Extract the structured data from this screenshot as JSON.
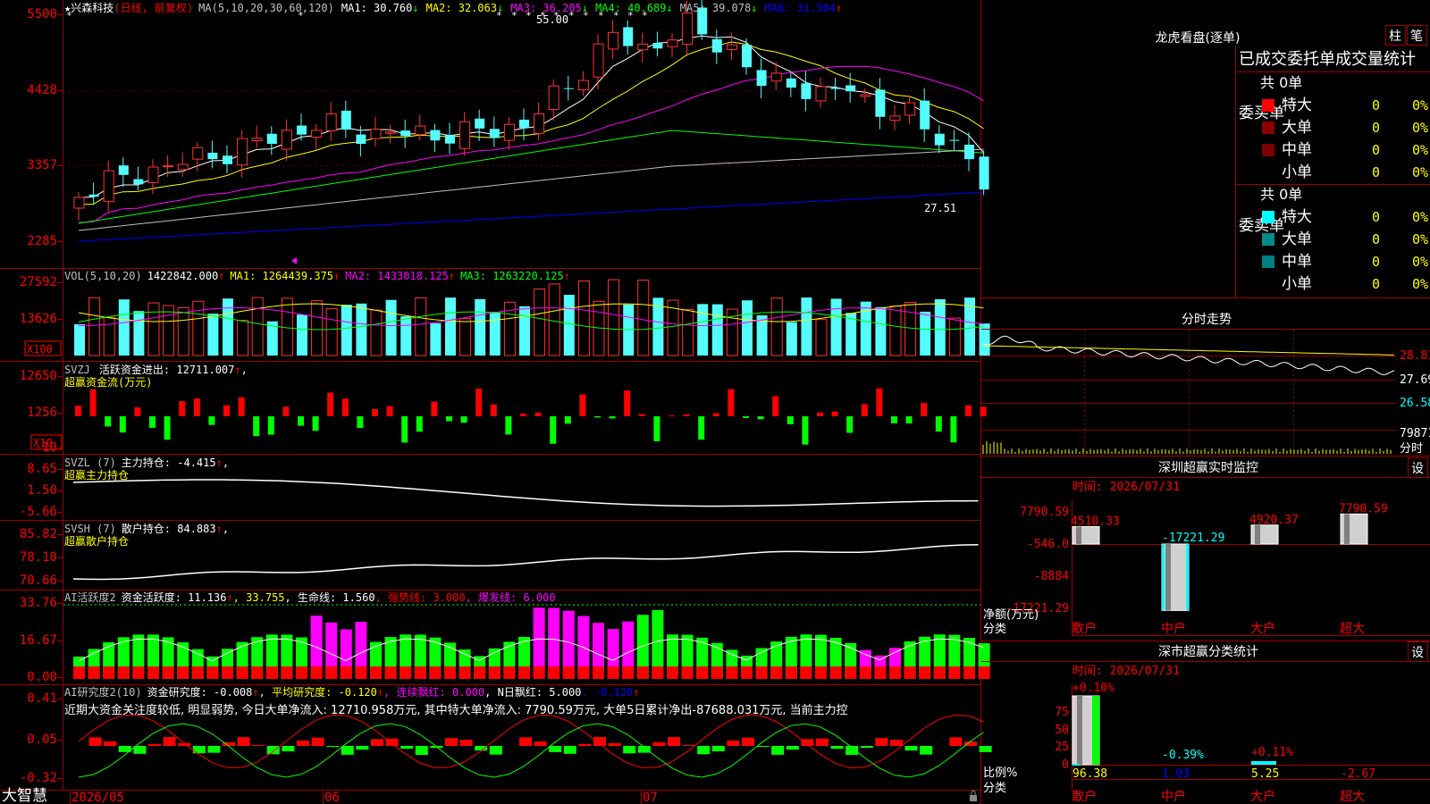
{
  "stock": {
    "prefix": "★",
    "name": "兴森科技",
    "mode": "(日线, 前复权)",
    "flag_icon": "star-icon"
  },
  "main": {
    "ma_spec": "MA(5,10,20,30,60,120)",
    "ma": [
      {
        "label": "MA1: 30.760",
        "arrow": "↓",
        "color": "#ffffff"
      },
      {
        "label": "MA2: 32.063",
        "arrow": "↓",
        "color": "#ffff00"
      },
      {
        "label": "MA3: 36.205",
        "arrow": "↓",
        "color": "#ff00ff"
      },
      {
        "label": "MA4: 40.689",
        "arrow": "↓",
        "color": "#00ff00"
      },
      {
        "label": "MA5: 39.078",
        "arrow": "↓",
        "color": "#c0c0c0"
      },
      {
        "label": "MA6: 31.504",
        "arrow": "↑",
        "color": "#0000ff"
      }
    ],
    "yticks": [
      "5500",
      "4428",
      "3357",
      "2285"
    ],
    "high_label": "55.00",
    "low_label": "27.51"
  },
  "vol": {
    "spec": "VOL(5,10,20)",
    "value": "1422842.000",
    "arrow": "↑",
    "ma": [
      {
        "label": "MA1: 1264439.375",
        "arrow": "↑",
        "color": "#ffff00"
      },
      {
        "label": "MA2: 1433018.125",
        "arrow": "↑",
        "color": "#ff00ff"
      },
      {
        "label": "MA3: 1263220.125",
        "arrow": "↑",
        "color": "#00ff00"
      }
    ],
    "yticks": [
      "27592",
      "13626"
    ],
    "unit": "X100"
  },
  "svzj": {
    "spec": "SVZJ",
    "title": "活跃资金进出: 12711.007",
    "arrow": "↑",
    "tail": ",",
    "sub": "超赢资金流(万元)",
    "yticks": [
      "12650",
      "1256",
      "-10"
    ],
    "unit": "X10"
  },
  "svzl": {
    "spec": "SVZL (7)",
    "title": "主力持仓: -4.415",
    "arrow": "↑",
    "tail": ",",
    "sub": "超赢主力持仓",
    "yticks": [
      "8.65",
      "1.50",
      "-5.66"
    ]
  },
  "svsh": {
    "spec": "SVSH (7)",
    "title": "散户持仓: 84.883",
    "arrow": "↑",
    "tail": ",",
    "sub": "超赢散户持仓",
    "yticks": [
      "85.82",
      "78.10",
      "70.66"
    ]
  },
  "ai1": {
    "spec": "AI活跃度2",
    "title": "资金活跃度: 11.136",
    "arrow": "↑",
    "v2": ", 33.755",
    "life": ", 生命线: 1.560",
    "strong": ", 强势线: 3.000",
    "burst": ", 爆发线: 6.000",
    "yticks": [
      "33.76",
      "16.67",
      "0.00"
    ]
  },
  "ai2": {
    "spec": "AI研究度2(10)",
    "title": "资金研究度: -0.008",
    "arrow": "↑",
    "avg": ", 平均研究度: -0.120",
    "avg_arrow": "↑",
    "cont": ", 连续飘红: 0.000",
    "nday": ", N日飘红: 5.000",
    "last": ", -0.120",
    "last_arrow": "↑",
    "comment": "近期大资金关注度较低, 明显弱势, 今日大单净流入: 12710.958万元, 其中特大单净流入: 7790.59万元, 大单5日累计净出-87688.031万元, 当前主力控",
    "yticks": [
      "0.41",
      "0.05",
      "-0.32"
    ]
  },
  "bottom": {
    "brand": "大智慧",
    "dates": [
      "2026/05",
      "06",
      "07"
    ]
  },
  "right": {
    "lhb_title": "龙虎看盘(逐单)",
    "tabs": [
      "柱",
      "笔"
    ],
    "stats_title": "已成交委托单成交量统计",
    "buy_label": "委买单",
    "sell_label": "委卖单",
    "buy_total": "共 0单",
    "sell_total": "共 0单",
    "buy_rows": [
      {
        "name": "特大",
        "v": "0",
        "p": "0%",
        "color": "#ff0000"
      },
      {
        "name": "大单",
        "v": "0",
        "p": "0%",
        "color": "#8b0000"
      },
      {
        "name": "中单",
        "v": "0",
        "p": "0%",
        "color": "#7a0000"
      },
      {
        "name": "小单",
        "v": "0",
        "p": "0%",
        "color": "#000000"
      }
    ],
    "sell_rows": [
      {
        "name": "特大",
        "v": "0",
        "p": "0%",
        "color": "#00ffff"
      },
      {
        "name": "大单",
        "v": "0",
        "p": "0%",
        "color": "#008b8b"
      },
      {
        "name": "中单",
        "v": "0",
        "p": "0%",
        "color": "#008080"
      },
      {
        "name": "小单",
        "v": "0",
        "p": "0%",
        "color": "#000000"
      }
    ],
    "intraday_title": "分时走势",
    "intraday_ticks": [
      "28.81",
      "27.69",
      "26.58"
    ],
    "intraday_vol": "79871",
    "intraday_unit": "分时",
    "monitor_title": "深圳超赢实时监控",
    "monitor_btn": "设",
    "monitor_time": "时间: 2026/07/31",
    "monitor_yticks": [
      "7790.59",
      "-546.0",
      "-8884",
      "-17221.29"
    ],
    "monitor_ylabel": "净额(万元)",
    "monitor_xlabel": "分类",
    "monitor_cats": [
      "散户",
      "中户",
      "大户",
      "超大"
    ],
    "monitor_vals": [
      "4510.33",
      "-17221.29",
      "4920.37",
      "7790.59"
    ],
    "cls_title": "深市超赢分类统计",
    "cls_btn": "设",
    "cls_time": "时间: 2026/07/31",
    "cls_yticks": [
      "75",
      "50",
      "25",
      "0"
    ],
    "cls_ylabel": "比例%",
    "cls_xlabel": "分类",
    "cls_cats": [
      "散户",
      "中户",
      "大户",
      "超大"
    ],
    "cls_top": [
      "+0.10%",
      "-0.39%",
      "+0.11%",
      ""
    ],
    "cls_vals": [
      "96.38",
      "1.03",
      "5.25",
      "-2.67"
    ]
  }
}
